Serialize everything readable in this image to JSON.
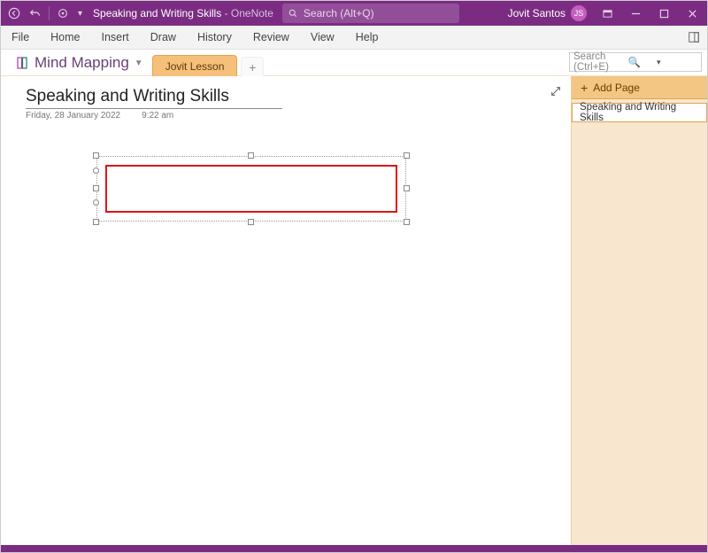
{
  "titlebar": {
    "doc_title": "Speaking and Writing Skills",
    "app_suffix": " - OneNote",
    "search_placeholder": "Search (Alt+Q)",
    "user_name": "Jovit Santos",
    "user_initials": "JS"
  },
  "ribbon": {
    "tabs": [
      "File",
      "Home",
      "Insert",
      "Draw",
      "History",
      "Review",
      "View",
      "Help"
    ]
  },
  "notebook": {
    "name": "Mind Mapping",
    "section_tab": "Jovit Lesson",
    "page_search_placeholder": "Search (Ctrl+E)"
  },
  "page": {
    "title": "Speaking and Writing Skills",
    "date": "Friday, 28 January 2022",
    "time": "9:22 am"
  },
  "sidebar": {
    "add_page_label": "Add Page",
    "pages": [
      "Speaking and Writing Skills"
    ]
  }
}
